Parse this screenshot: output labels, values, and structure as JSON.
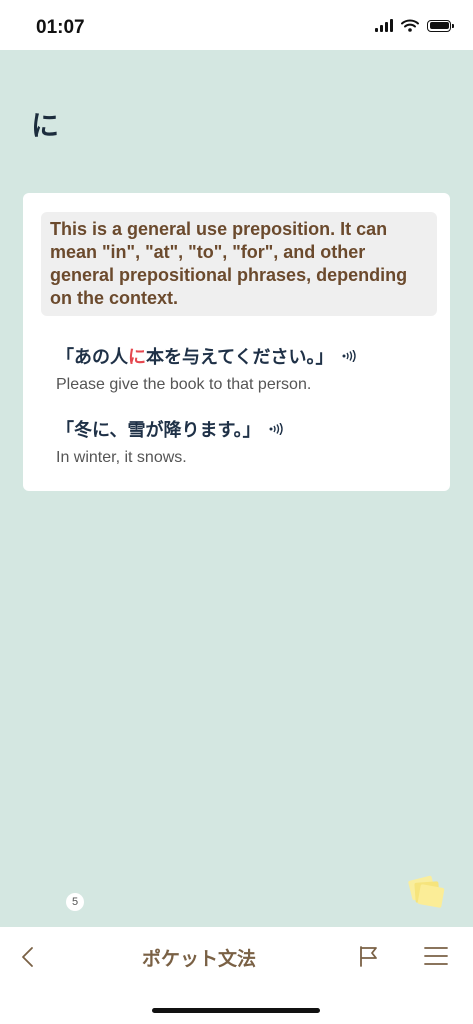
{
  "status_bar": {
    "time": "01:07"
  },
  "grammar": {
    "title": "に",
    "description": "This is a general use preposition. It can mean \"in\", \"at\", \"to\", \"for\", and other general prepositional phrases, depending on the context.",
    "examples": [
      {
        "jp_before": "「あの人",
        "jp_highlight": "に",
        "jp_after": "本を与えてください。」",
        "en": "Please give the book to that person."
      },
      {
        "jp_before": "「冬に、雪が降ります。」",
        "jp_highlight": "",
        "jp_after": "",
        "en": "In winter, it snows."
      }
    ]
  },
  "badge": {
    "count": "5"
  },
  "nav": {
    "title": "ポケット文法"
  },
  "colors": {
    "background": "#d4e7e1",
    "highlight": "#e5474f",
    "description_text": "#6b4a2d",
    "nav_title": "#7a6145"
  }
}
